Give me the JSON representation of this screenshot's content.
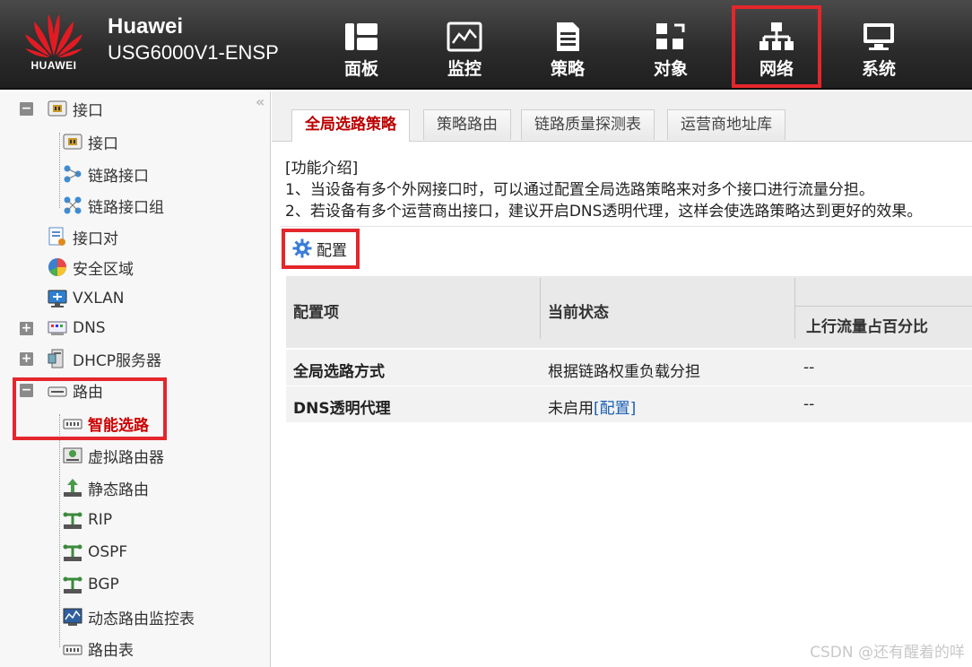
{
  "header": {
    "logo_text": "HUAWEI",
    "brand_name": "Huawei",
    "model": "USG6000V1-ENSP",
    "nav": [
      {
        "label": "面板",
        "icon": "dashboard-icon"
      },
      {
        "label": "监控",
        "icon": "monitor-icon"
      },
      {
        "label": "策略",
        "icon": "policy-icon"
      },
      {
        "label": "对象",
        "icon": "object-icon"
      },
      {
        "label": "网络",
        "icon": "network-icon",
        "active": true
      },
      {
        "label": "系统",
        "icon": "system-icon"
      }
    ]
  },
  "sidebar": {
    "collapse_glyph": "«",
    "items": [
      {
        "label": "接口",
        "icon": "interface-icon",
        "toggle": "−"
      },
      {
        "label": "接口",
        "icon": "interface-icon"
      },
      {
        "label": "链路接口",
        "icon": "link-interface-icon"
      },
      {
        "label": "链路接口组",
        "icon": "link-interface-group-icon"
      },
      {
        "label": "接口对",
        "icon": "interface-pair-icon"
      },
      {
        "label": "安全区域",
        "icon": "security-zone-icon"
      },
      {
        "label": "VXLAN",
        "icon": "vxlan-icon"
      },
      {
        "label": "DNS",
        "icon": "dns-icon",
        "toggle": "+"
      },
      {
        "label": "DHCP服务器",
        "icon": "dhcp-server-icon",
        "toggle": "+"
      },
      {
        "label": "路由",
        "icon": "router-icon",
        "toggle": "−"
      },
      {
        "label": "智能选路",
        "icon": "smart-routing-icon",
        "selected": true
      },
      {
        "label": "虚拟路由器",
        "icon": "virtual-router-icon"
      },
      {
        "label": "静态路由",
        "icon": "static-route-icon"
      },
      {
        "label": "RIP",
        "icon": "rip-icon"
      },
      {
        "label": "OSPF",
        "icon": "ospf-icon"
      },
      {
        "label": "BGP",
        "icon": "bgp-icon"
      },
      {
        "label": "动态路由监控表",
        "icon": "dynamic-route-monitor-icon"
      },
      {
        "label": "路由表",
        "icon": "routing-table-icon"
      }
    ]
  },
  "tabs": [
    {
      "label": "全局选路策略",
      "active": true
    },
    {
      "label": "策略路由"
    },
    {
      "label": "链路质量探测表"
    },
    {
      "label": "运营商地址库"
    }
  ],
  "intro": {
    "title": "[功能介绍]",
    "line1": "1、当设备有多个外网接口时，可以通过配置全局选路策略来对多个接口进行流量分担。",
    "line2": "2、若设备有多个运营商出接口，建议开启DNS透明代理，这样会使选路策略达到更好的效果。"
  },
  "toolbar": {
    "config_label": "配置",
    "config_icon": "gear-icon"
  },
  "table": {
    "headers": {
      "item": "配置项",
      "status": "当前状态",
      "upstream": "上行流量占百分比"
    },
    "rows": [
      {
        "item": "全局选路方式",
        "status": "根据链路权重负载分担",
        "status_link": "",
        "upstream": "--"
      },
      {
        "item": "DNS透明代理",
        "status": "未启用",
        "status_link": "[配置]",
        "upstream": "--"
      }
    ]
  },
  "watermark": "CSDN @还有醒着的咩",
  "colors": {
    "accent_red": "#e5262c",
    "selected_text": "#cc0000",
    "link": "#1a5fb4",
    "header_bg": "#2c2c2c"
  }
}
